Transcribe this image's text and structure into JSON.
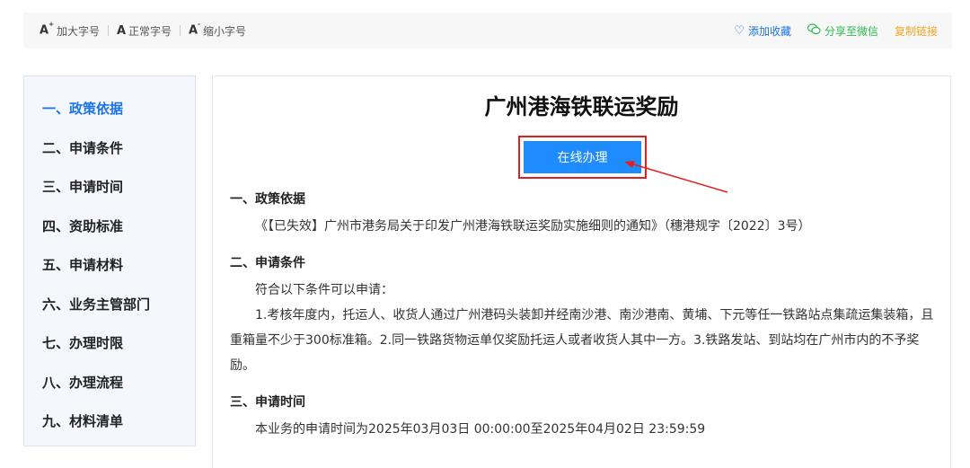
{
  "toolbar": {
    "font_tools": [
      {
        "glyph": "A",
        "sup": "+",
        "label": "加大字号"
      },
      {
        "glyph": "A",
        "sup": "",
        "label": "正常字号"
      },
      {
        "glyph": "A",
        "sup": "-",
        "label": "缩小字号"
      }
    ],
    "favorite_label": "添加收藏",
    "wechat_label": "分享至微信",
    "copy_label": "复制链接"
  },
  "sidebar": {
    "items": [
      {
        "label": "一、政策依据",
        "active": true
      },
      {
        "label": "二、申请条件"
      },
      {
        "label": "三、申请时间"
      },
      {
        "label": "四、资助标准"
      },
      {
        "label": "五、申请材料"
      },
      {
        "label": "六、业务主管部门"
      },
      {
        "label": "七、办理时限"
      },
      {
        "label": "八、办理流程"
      },
      {
        "label": "九、材料清单"
      }
    ]
  },
  "main": {
    "title": "广州港海铁联运奖励",
    "apply_button": "在线办理",
    "sections": {
      "policy": {
        "title": "一、政策依据",
        "text": "《【已失效】广州市港务局关于印发广州港海铁联运奖励实施细则的通知》（穗港规字〔2022〕3号）"
      },
      "conditions": {
        "title": "二、申请条件",
        "intro": "符合以下条件可以申请：",
        "text": "1.考核年度内，托运人、收货人通过广州港码头装卸并经南沙港、南沙港南、黄埔、下元等任一铁路站点集疏运集装箱，且重箱量不少于300标准箱。2.同一铁路货物运单仅奖励托运人或者收货人其中一方。3.铁路发站、到站均在广州市内的不予奖励。"
      },
      "time": {
        "title": "三、申请时间",
        "text": "本业务的申请时间为2025年03月03日 00:00:00至2025年04月02日 23:59:59"
      }
    }
  },
  "colors": {
    "accent": "#1a73e8",
    "button": "#1e8cff",
    "annotation": "#e02020",
    "wechat": "#2db84d",
    "copy": "#f5a623"
  }
}
